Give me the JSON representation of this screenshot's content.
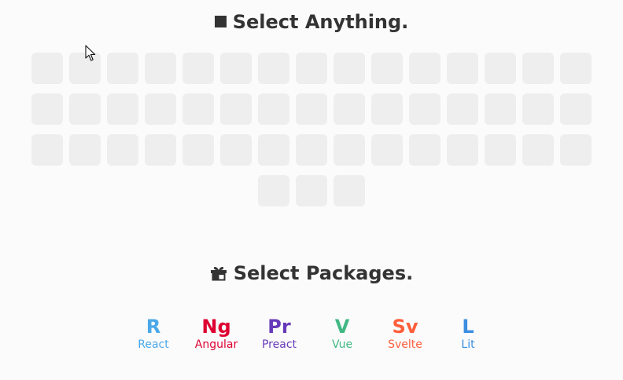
{
  "anything": {
    "title": "Select Anything.",
    "tile_count": 48
  },
  "packages": {
    "title": "Select Packages.",
    "items": [
      {
        "abbr": "R",
        "name": "React",
        "color": "#4aa8e8"
      },
      {
        "abbr": "Ng",
        "name": "Angular",
        "color": "#dd0031"
      },
      {
        "abbr": "Pr",
        "name": "Preact",
        "color": "#673ab8"
      },
      {
        "abbr": "V",
        "name": "Vue",
        "color": "#41b883"
      },
      {
        "abbr": "Sv",
        "name": "Svelte",
        "color": "#ff5e3a"
      },
      {
        "abbr": "L",
        "name": "Lit",
        "color": "#3a8de0"
      }
    ]
  },
  "colors": {
    "background": "#fbfbfb",
    "tile": "#eeeeee",
    "text": "#333333"
  },
  "icons": {
    "anything_title_icon": "black-square-icon",
    "packages_title_icon": "gift-icon",
    "pointer": "mouse-cursor-icon"
  }
}
